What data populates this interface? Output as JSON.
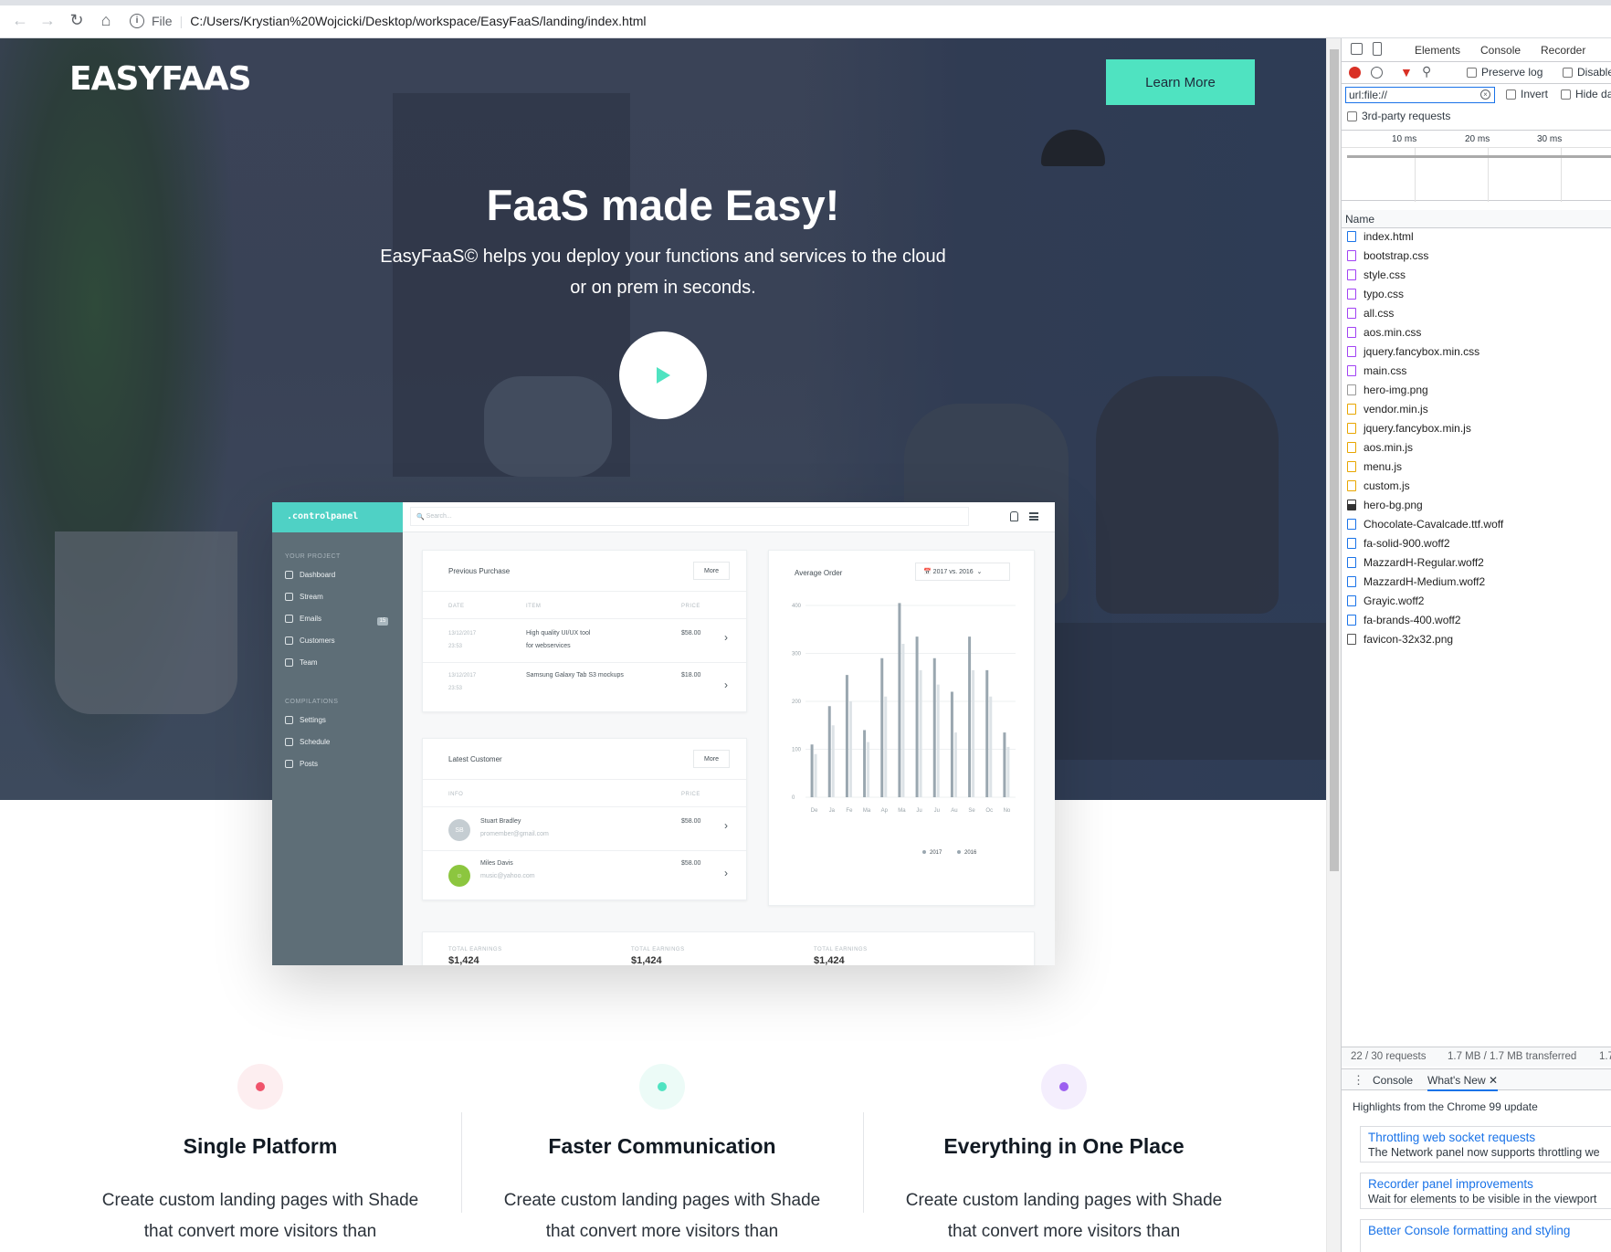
{
  "browser": {
    "scheme_label": "File",
    "url": "C:/Users/Krystian%20Wojcicki/Desktop/workspace/EasyFaaS/landing/index.html"
  },
  "hero": {
    "logo": "EASYFAAS",
    "cta_label": "Learn More",
    "title": "FaaS made Easy!",
    "subtitle": "EasyFaaS© helps you deploy your functions and services to the cloud or on prem in seconds.",
    "colors": {
      "accent": "#4fe3c1",
      "overlay": "#3a4357"
    }
  },
  "dashboard": {
    "brand": ".controlpanel",
    "search_placeholder": "Search...",
    "sidebar": {
      "section1": "YOUR PROJECT",
      "items1": [
        "Dashboard",
        "Stream",
        "Emails",
        "Customers",
        "Team"
      ],
      "emails_badge": "15",
      "section2": "COMPILATIONS",
      "items2": [
        "Settings",
        "Schedule",
        "Posts"
      ]
    },
    "previous_purchase": {
      "title": "Previous Purchase",
      "more": "More",
      "headers": [
        "DATE",
        "ITEM",
        "PRICE"
      ],
      "rows": [
        {
          "date": "13/12/2017",
          "time": "23:53",
          "item_line1": "High quality UI/UX tool",
          "item_line2": "for webservices",
          "price": "$58.00"
        },
        {
          "date": "13/12/2017",
          "time": "23:53",
          "item_line1": "Samsung Galaxy Tab S3 mockups",
          "item_line2": "",
          "price": "$18.00"
        }
      ]
    },
    "latest_customer": {
      "title": "Latest Customer",
      "more": "More",
      "headers": [
        "INFO",
        "PRICE"
      ],
      "rows": [
        {
          "initials": "SB",
          "name": "Stuart Bradley",
          "email": "promember@gmail.com",
          "price": "$58.00"
        },
        {
          "initials": "",
          "name": "Miles Davis",
          "email": "music@yahoo.com",
          "price": "$58.00"
        }
      ]
    },
    "totals": [
      "TOTAL EARNINGS",
      "TOTAL EARNINGS",
      "TOTAL EARNINGS"
    ],
    "totals_value": "$1,424"
  },
  "chart_data": {
    "type": "bar",
    "title": "Average Order",
    "selector": "2017 vs. 2016",
    "categories": [
      "De",
      "Ja",
      "Fe",
      "Ma",
      "Ap",
      "Ma",
      "Ju",
      "Ju",
      "Au",
      "Se",
      "Oc",
      "No"
    ],
    "yticks": [
      0,
      100,
      200,
      300,
      400
    ],
    "ylim": [
      0,
      400
    ],
    "series": [
      {
        "name": "2017",
        "color": "#9aa7b0",
        "values": [
          110,
          190,
          255,
          140,
          290,
          405,
          335,
          290,
          220,
          335,
          265,
          135
        ]
      },
      {
        "name": "2016",
        "color": "#dde3e7",
        "values": [
          90,
          150,
          200,
          115,
          210,
          320,
          265,
          235,
          135,
          265,
          210,
          105
        ]
      }
    ],
    "legend_position": "bottom-right"
  },
  "features": [
    {
      "title": "Single Platform",
      "text": "Create custom landing pages with Shade that convert more visitors than",
      "dot_color": "#f0536b",
      "bg_color": "#fdeef0"
    },
    {
      "title": "Faster Communication",
      "text": "Create custom landing pages with Shade that convert more visitors than",
      "dot_color": "#4fe3c1",
      "bg_color": "#ecfbf7"
    },
    {
      "title": "Everything in One Place",
      "text": "Create custom landing pages with Shade that convert more visitors than",
      "dot_color": "#9c5ff0",
      "bg_color": "#f4eefd"
    }
  ],
  "devtools": {
    "tabs": [
      "Elements",
      "Console",
      "Recorder"
    ],
    "preserve_log": "Preserve log",
    "disable_cache": "Disable",
    "filter_value": "url:file://",
    "invert": "Invert",
    "hide_data": "Hide da",
    "third_party": "3rd-party requests",
    "timeline_ticks": [
      "10 ms",
      "20 ms",
      "30 ms"
    ],
    "name_header": "Name",
    "files": [
      {
        "name": "index.html",
        "kind": "doc"
      },
      {
        "name": "bootstrap.css",
        "kind": "css"
      },
      {
        "name": "style.css",
        "kind": "css"
      },
      {
        "name": "typo.css",
        "kind": "css"
      },
      {
        "name": "all.css",
        "kind": "css"
      },
      {
        "name": "aos.min.css",
        "kind": "css"
      },
      {
        "name": "jquery.fancybox.min.css",
        "kind": "css"
      },
      {
        "name": "main.css",
        "kind": "css"
      },
      {
        "name": "hero-img.png",
        "kind": "img"
      },
      {
        "name": "vendor.min.js",
        "kind": "js"
      },
      {
        "name": "jquery.fancybox.min.js",
        "kind": "js"
      },
      {
        "name": "aos.min.js",
        "kind": "js"
      },
      {
        "name": "menu.js",
        "kind": "js"
      },
      {
        "name": "custom.js",
        "kind": "js"
      },
      {
        "name": "hero-bg.png",
        "kind": "img2"
      },
      {
        "name": "Chocolate-Cavalcade.ttf.woff",
        "kind": "font"
      },
      {
        "name": "fa-solid-900.woff2",
        "kind": "font"
      },
      {
        "name": "MazzardH-Regular.woff2",
        "kind": "font"
      },
      {
        "name": "MazzardH-Medium.woff2",
        "kind": "font"
      },
      {
        "name": "Grayic.woff2",
        "kind": "font"
      },
      {
        "name": "fa-brands-400.woff2",
        "kind": "font"
      },
      {
        "name": "favicon-32x32.png",
        "kind": "blank"
      }
    ],
    "status_requests": "22 / 30 requests",
    "status_transferred": "1.7 MB / 1.7 MB transferred",
    "status_extra": "1.7",
    "drawer_tabs": [
      "Console",
      "What's New"
    ],
    "whats_new_header": "Highlights from the Chrome 99 update",
    "whats_new": [
      {
        "title": "Throttling web socket requests",
        "text": "The Network panel now supports throttling we"
      },
      {
        "title": "Recorder panel improvements",
        "text": "Wait for elements to be visible in the viewport"
      },
      {
        "title": "Better Console formatting and styling",
        "text": ""
      }
    ]
  }
}
